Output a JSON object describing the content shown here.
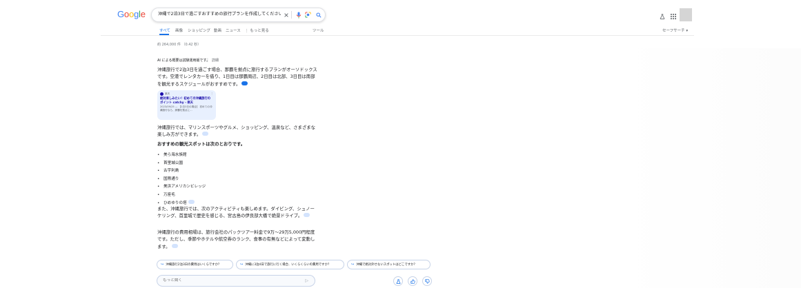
{
  "logo": {
    "text": "Google",
    "letters": [
      "G",
      "o",
      "o",
      "g",
      "l",
      "e"
    ],
    "colors": [
      "#4285F4",
      "#EA4335",
      "#FBBC05",
      "#4285F4",
      "#34A853",
      "#EA4335"
    ]
  },
  "search": {
    "query": "沖縄で2泊3日で過ごすおすすめの旅行プランを作成してください",
    "clear_icon": "close-icon",
    "mic_icon": "microphone-icon",
    "lens_icon": "camera-lens-icon",
    "search_icon": "search-icon"
  },
  "header": {
    "labs_icon": "flask-icon",
    "apps_icon": "apps-grid-icon"
  },
  "tabs": [
    {
      "label": "すべて",
      "active": true
    },
    {
      "label": "画像"
    },
    {
      "label": "ショッピング"
    },
    {
      "label": "動画"
    },
    {
      "label": "ニュース"
    },
    {
      "label": "⋮ もっと見る"
    },
    {
      "label": "ツール"
    }
  ],
  "safesearch": "セーフサーチ ▾",
  "result_stats": "約 264,000 件 （0.42 秒）",
  "ai": {
    "header": "AI による概要は試験運用版です。",
    "header_more": "詳細",
    "intro": "沖縄旅行で2泊3日を過ごす場合、那覇を拠点に旅行するプランがオーソドックスです。空港でレンタカーを借り、1日目は那覇周辺、2日目は北部、3日目は南部を観光するスケジュールがおすすめです。",
    "source_card": {
      "site": "楽天",
      "title": "絶対楽しみたい！初めての沖縄旅行のポイント catchy - 楽天",
      "snippet": "2023/09/25 — 【2泊3日の場合】 初めての沖縄旅行なら、那覇を拠点に…"
    },
    "activities": "沖縄旅行では、マリンスポーツやグルメ、ショッピング、温泉など、さまざまな楽しみ方ができます。",
    "spots_heading": "おすすめの観光スポットは次のとおりです。",
    "spots": [
      "美ら海水族館",
      "首里城公園",
      "古宇利島",
      "国際通り",
      "美浜アメリカンビレッジ",
      "万座毛",
      "ひめゆりの塔"
    ],
    "activities2": "また、沖縄旅行では、次のアクティビティも楽しめます。ダイビング、シュノーケリング、首里城で歴史を感じる、宮古島の伊良部大橋で絶景ドライブ。",
    "cost": "沖縄旅行の費用相場は、旅行会社のパックツアー料金で9万〜29万5,000円程度です。ただし、季節やホテルや航空券のランク、食事の有無などによって変動します。"
  },
  "followups": [
    "沖縄旅行2泊3日の費用はいくらですか？",
    "沖縄に3泊4日で旅行に行く場合、いくらくらいの費用ですか？",
    "沖縄で絶対外せないスポットはどこですか？"
  ],
  "ask": {
    "placeholder": "もっと聞く"
  },
  "feedback_icons": [
    "flask-icon",
    "thumbs-up-icon",
    "thumbs-down-icon"
  ]
}
